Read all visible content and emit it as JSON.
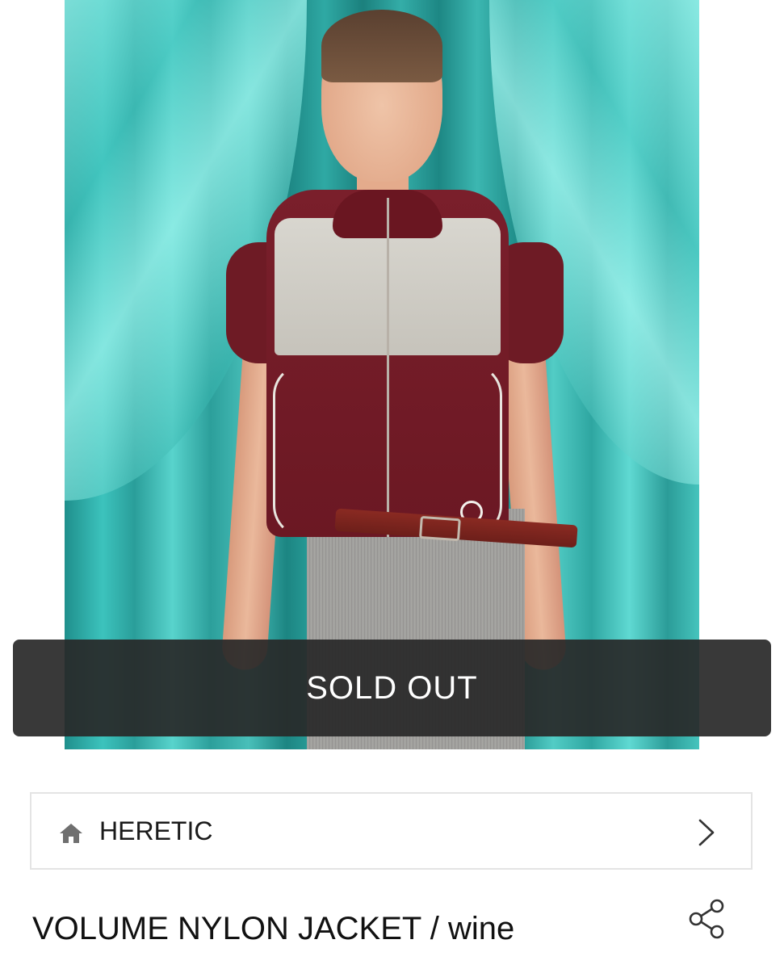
{
  "product": {
    "sold_out_label": "SOLD OUT",
    "title": "VOLUME NYLON JACKET / wine"
  },
  "brand": {
    "name": "HERETIC",
    "icon": "home-icon",
    "nav_icon": "chevron-right-icon"
  },
  "actions": {
    "share_icon": "share-icon"
  },
  "colors": {
    "overlay": "#282828",
    "background_curtain": "#3cc3bd",
    "jacket": "#7a1f2b"
  }
}
